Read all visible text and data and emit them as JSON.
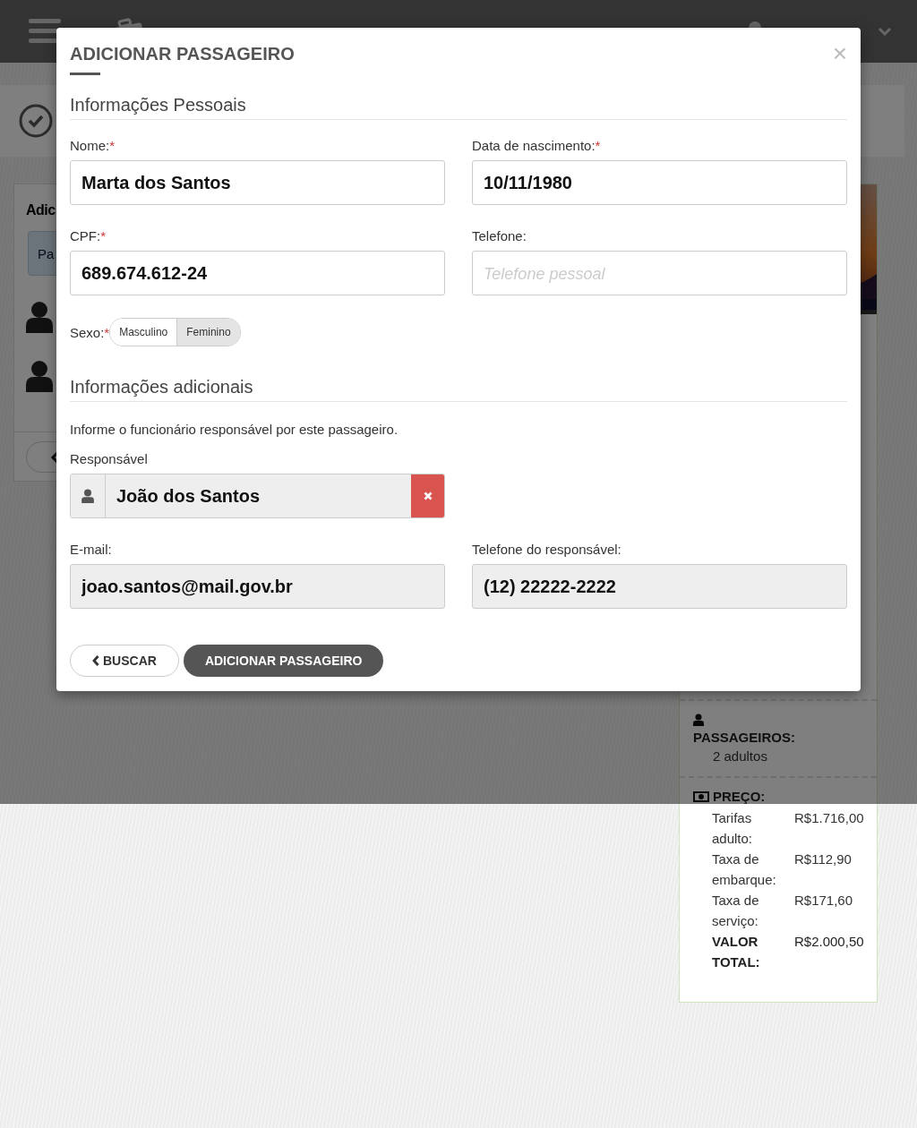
{
  "left_card": {
    "heading": "Adic",
    "tab": "Pa"
  },
  "sidebar": {
    "passengers": {
      "label": "PASSAGEIROS:",
      "value": "2 adultos"
    },
    "price": {
      "label": "PREÇO:",
      "rows": [
        {
          "label": "Tarifas adulto:",
          "value": "R$1.716,00",
          "kind": "item"
        },
        {
          "label": "Taxa de embarque:",
          "value": "R$112,90",
          "kind": "item"
        },
        {
          "label": "Taxa de serviço:",
          "value": "R$171,60",
          "kind": "item"
        },
        {
          "label": "VALOR TOTAL:",
          "value": "R$2.000,50",
          "kind": "total"
        }
      ]
    }
  },
  "modal": {
    "title": "ADICIONAR PASSAGEIRO",
    "close": "×",
    "personal": {
      "heading": "Informações Pessoais",
      "fields": [
        {
          "label": "Nome:",
          "mark": "*",
          "value": "Marta dos Santos"
        },
        {
          "label": "Data de nascimento:",
          "mark": "*",
          "value": "10/11/1980"
        },
        {
          "label": "CPF:",
          "mark": "*",
          "value": "689.674.612-24"
        },
        {
          "label": "Telefone:",
          "placeholder": "Telefone pessoal"
        }
      ],
      "sex": {
        "label": "Sexo:",
        "mark": "*",
        "options": [
          {
            "label": "Masculino",
            "selected": false
          },
          {
            "label": "Feminino",
            "selected": true
          }
        ]
      }
    },
    "additional": {
      "heading": "Informações adicionais",
      "note": "Informe o funcionário responsável por este passageiro.",
      "responsible": {
        "label": "Responsável",
        "value": "João dos Santos"
      },
      "fields": [
        {
          "label": "E-mail:",
          "value": "joao.santos@mail.gov.br"
        },
        {
          "label": "Telefone do responsável:",
          "value": "(12) 22222-2222"
        }
      ]
    },
    "buttons": [
      {
        "label": "BUSCAR",
        "kind": "back"
      },
      {
        "label": "ADICIONAR PASSAGEIRO",
        "kind": "primary"
      }
    ]
  }
}
